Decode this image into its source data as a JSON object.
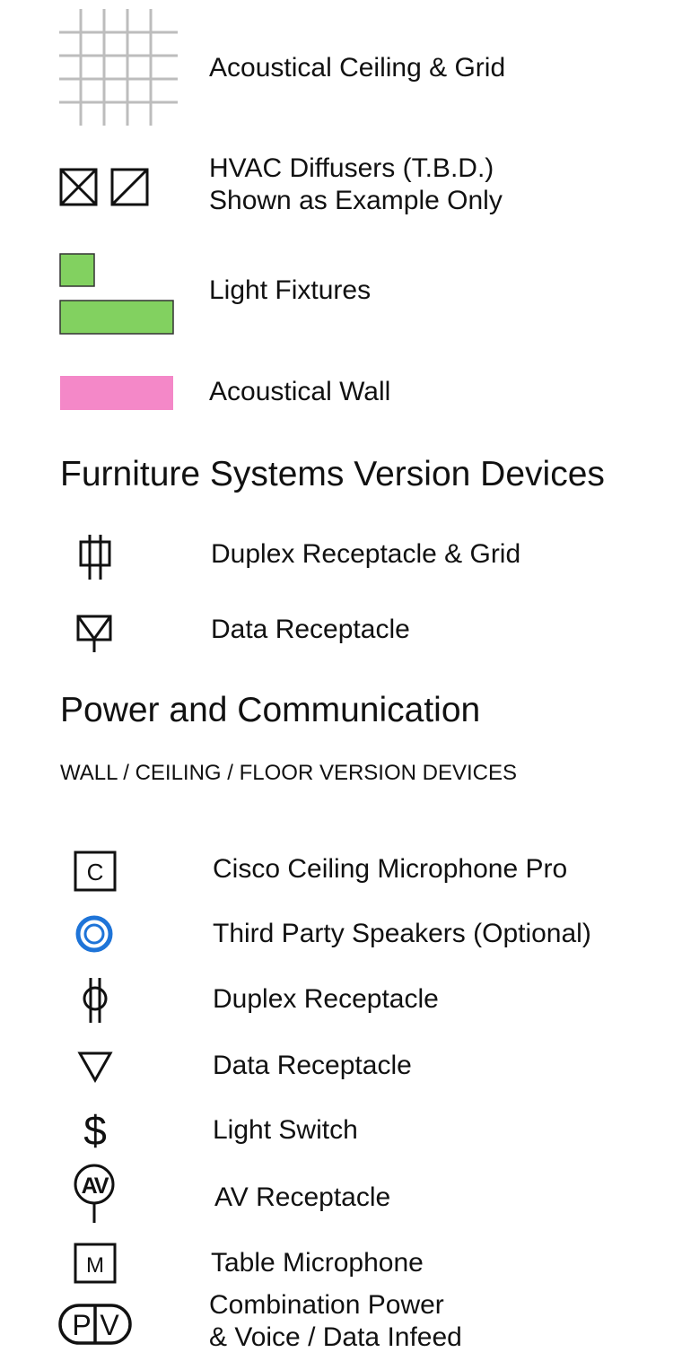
{
  "legend_top": {
    "ceiling_grid": "Acoustical Ceiling & Grid",
    "hvac_line1": "HVAC Diffusers (T.B.D.)",
    "hvac_line2": "Shown as Example Only",
    "light_fixtures": "Light Fixtures",
    "acoustical_wall": "Acoustical Wall"
  },
  "furniture_section": {
    "heading": "Furniture Systems Version Devices",
    "items": [
      {
        "label": "Duplex Receptacle & Grid",
        "icon": "duplex-receptacle-grid-icon"
      },
      {
        "label": "Data Receptacle",
        "icon": "data-receptacle-stem-icon"
      }
    ]
  },
  "power_section": {
    "heading": "Power and Communication",
    "subheading": "WALL / CEILING / FLOOR VERSION DEVICES",
    "items": [
      {
        "label": "Cisco Ceiling Microphone Pro",
        "icon": "ceiling-microphone-icon",
        "glyph": "C"
      },
      {
        "label": "Third Party Speakers (Optional)",
        "icon": "speaker-icon"
      },
      {
        "label": "Duplex Receptacle",
        "icon": "duplex-receptacle-icon"
      },
      {
        "label": "Data Receptacle",
        "icon": "data-receptacle-icon"
      },
      {
        "label": "Light Switch",
        "icon": "light-switch-icon",
        "glyph": "$"
      },
      {
        "label": "AV Receptacle",
        "icon": "av-receptacle-icon",
        "glyph": "AV"
      },
      {
        "label": "Table Microphone",
        "icon": "table-microphone-icon",
        "glyph": "M"
      },
      {
        "label_line1": "Combination Power",
        "label_line2": "& Voice / Data Infeed",
        "icon": "combination-infeed-icon",
        "glyph_left": "P",
        "glyph_right": "V"
      }
    ]
  },
  "colors": {
    "grid": "#bdbdbd",
    "light_fixture": "#82d160",
    "acoustical_wall": "#f488c8",
    "speaker": "#1e74d8",
    "stroke": "#111111"
  }
}
